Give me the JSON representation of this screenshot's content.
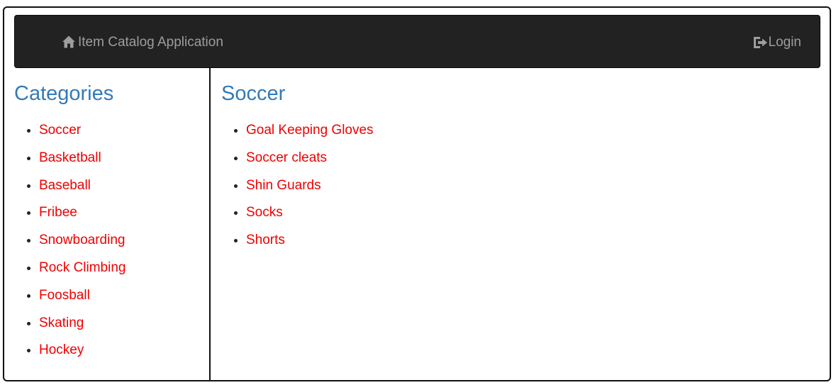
{
  "navbar": {
    "brand": "Item Catalog Application",
    "brand_icon": "home-icon",
    "login": "Login",
    "login_icon": "log-in-icon"
  },
  "sidebar": {
    "title": "Categories",
    "items": [
      "Soccer",
      "Basketball",
      "Baseball",
      "Fribee",
      "Snowboarding",
      "Rock Climbing",
      "Foosball",
      "Skating",
      "Hockey"
    ]
  },
  "main": {
    "title": "Soccer",
    "items": [
      "Goal Keeping Gloves",
      "Soccer cleats",
      "Shin Guards",
      "Socks",
      "Shorts"
    ]
  },
  "colors": {
    "navbar_bg": "#222222",
    "navbar_text": "#9d9d9d",
    "heading": "#337ab7",
    "link": "#ee0000"
  }
}
